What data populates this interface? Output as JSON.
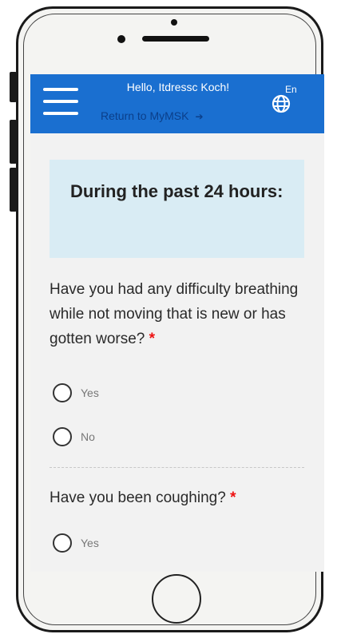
{
  "header": {
    "greeting": "Hello, Itdressc Koch!",
    "return_link": "Return to MyMSK",
    "language_label": "En",
    "color": "#1a6fd0"
  },
  "section": {
    "title": "During the past 24 hours:"
  },
  "questions": [
    {
      "text": "Have you had any difficulty breathing while not moving that is new or has gotten worse?",
      "required_mark": "*",
      "options": [
        "Yes",
        "No"
      ]
    },
    {
      "text": "Have you been coughing?",
      "required_mark": "*",
      "options": [
        "Yes"
      ]
    }
  ],
  "icons": {
    "menu": "hamburger-menu-icon",
    "language": "globe-icon",
    "exit": "exit-icon"
  }
}
